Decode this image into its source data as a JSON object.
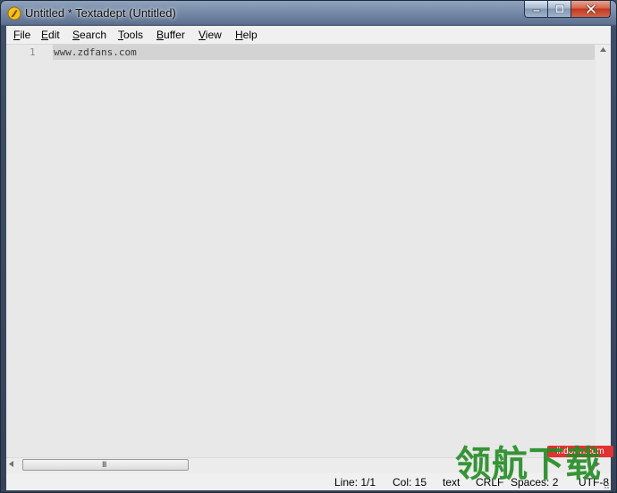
{
  "window": {
    "title": "Untitled * Textadept (Untitled)"
  },
  "menu": {
    "items": [
      {
        "mnemonic": "F",
        "rest": "ile"
      },
      {
        "mnemonic": "E",
        "rest": "dit"
      },
      {
        "mnemonic": "S",
        "rest": "earch"
      },
      {
        "mnemonic": "T",
        "rest": "ools"
      },
      {
        "mnemonic": "B",
        "rest": "uffer"
      },
      {
        "mnemonic": "V",
        "rest": "iew"
      },
      {
        "mnemonic": "H",
        "rest": "elp"
      }
    ]
  },
  "editor": {
    "line_number": "1",
    "line_text": "www.zdfans.com"
  },
  "scrollbar": {
    "grip": "III"
  },
  "status": {
    "line": "Line: 1/1",
    "col": "Col: 15",
    "lexer": "text",
    "eol": "CRLF",
    "indent": "Spaces: 2",
    "encoding": "UTF-8"
  },
  "watermark": {
    "url": "lhdown.com",
    "text": "领航下载"
  },
  "colors": {
    "editor_bg": "#e8e8e8",
    "current_line": "#d3d3d3",
    "watermark_green": "#228b22",
    "watermark_red": "#e23232"
  }
}
